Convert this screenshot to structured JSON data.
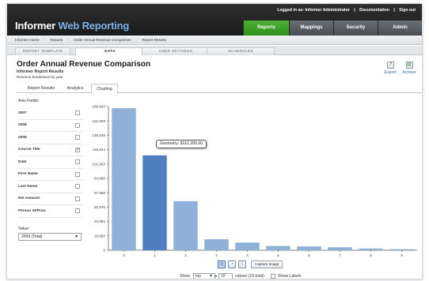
{
  "app": {
    "logo_main": "Informer",
    "logo_accent": " Web Reporting"
  },
  "userbar": {
    "logged_in": "Logged in as: Informer Administrator",
    "sep1": "|",
    "documentation": "Documentation",
    "sep2": "|",
    "sign_out": "Sign out"
  },
  "nav": {
    "tabs": [
      {
        "label": "Reports",
        "active": true
      },
      {
        "label": "Mappings",
        "active": false
      },
      {
        "label": "Security",
        "active": false
      },
      {
        "label": "Admin",
        "active": false
      }
    ]
  },
  "breadcrumb": [
    "Informer Home",
    "Reports",
    "Order Annual Revenue Comparison",
    "Report Results"
  ],
  "subtabs": [
    {
      "label": "REPORT TEMPLATE",
      "active": false
    },
    {
      "label": "DATA",
      "active": true
    },
    {
      "label": "USER SETTINGS",
      "active": false
    },
    {
      "label": "SCHEDULES",
      "active": false
    }
  ],
  "report": {
    "title": "Order Annual Revenue Comparison",
    "subtitle": "Informer Report Results",
    "description": "Revenue breakdown by year"
  },
  "toolbar": {
    "export": "Export",
    "archive": "Archive"
  },
  "view_tabs": [
    {
      "label": "Report Results",
      "active": false
    },
    {
      "label": "Analytics",
      "active": false
    },
    {
      "label": "Charting",
      "active": true
    }
  ],
  "axis_fields": {
    "title": "Axis Fields:",
    "fields": [
      {
        "label": "2007",
        "checked": false
      },
      {
        "label": "2008",
        "checked": false
      },
      {
        "label": "2009",
        "checked": false
      },
      {
        "label": "Course Title",
        "checked": true
      },
      {
        "label": "Date",
        "checked": false
      },
      {
        "label": "First Name",
        "checked": false
      },
      {
        "label": "Last Name",
        "checked": false
      },
      {
        "label": "Net Amount",
        "checked": false
      },
      {
        "label": "Person St/Prov.",
        "checked": false
      }
    ]
  },
  "value_select": {
    "label": "Value:",
    "selected": "2009 (Total)"
  },
  "chart_data": {
    "type": "bar",
    "categories": [
      "0",
      "1",
      "2",
      "3",
      "4",
      "5",
      "6",
      "7",
      "8",
      "9"
    ],
    "values": [
      168000,
      112200,
      58000,
      13000,
      9000,
      5000,
      4500,
      3500,
      2000,
      1200
    ],
    "yticks": [
      0,
      16992,
      33984,
      50976,
      67968,
      84960,
      101952,
      118944,
      135936,
      152928,
      169920
    ],
    "ytick_labels": [
      "0",
      "16,992",
      "33,984",
      "50,976",
      "67,968",
      "84,960",
      "101,952",
      "118,944",
      "135,936",
      "152,928",
      "169,920"
    ],
    "ylim": [
      0,
      169920
    ],
    "highlight_index": 1,
    "colors": {
      "bar": "#8fb0d8",
      "highlight": "#4f7ec0"
    },
    "tooltip": "Geometry: $112,200.00",
    "xlabel": "",
    "ylabel": "",
    "title": ""
  },
  "chart_tools": {
    "capture": "Capture Image",
    "icons": [
      "bar-chart-icon",
      "pie-chart-icon",
      "line-chart-icon"
    ]
  },
  "show_row": {
    "show": "Show",
    "mode": "top",
    "count": "10",
    "values_text": "values (19 total)",
    "show_labels": "Show Labels"
  }
}
